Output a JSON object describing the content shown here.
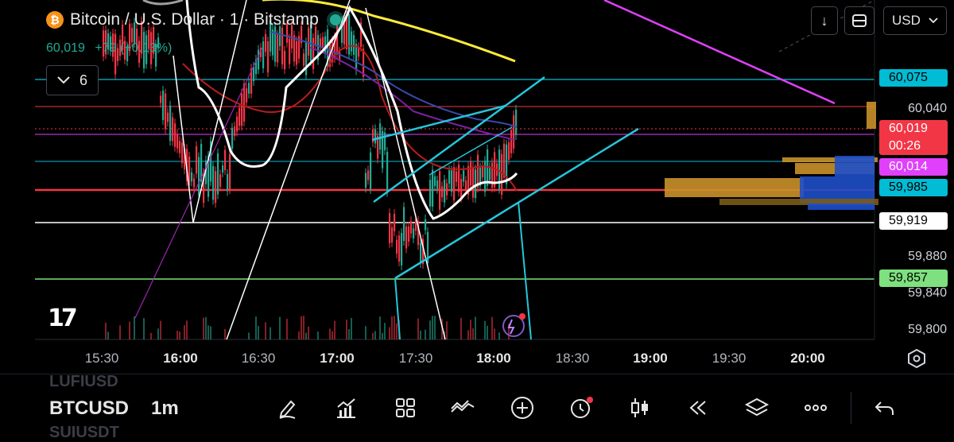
{
  "header": {
    "logo_glyph": "₿",
    "symbol_title": "Bitcoin / U.S. Dollar · 1 · Bitstamp",
    "last_price": "60,019",
    "change": "+79 (+0.13%)",
    "indicators_count": "6",
    "currency": "USD",
    "download_icon": "↓"
  },
  "price_axis": {
    "labels": [
      "60,040",
      "59,880",
      "59,840",
      "59,800"
    ],
    "badges": [
      {
        "text": "60,075",
        "bg": "#00bcd4",
        "fg": "#000000"
      },
      {
        "text": "60,019",
        "bg": "#f23645",
        "fg": "#ffffff"
      },
      {
        "text": "00:26",
        "bg": "#f23645",
        "fg": "#ffffff"
      },
      {
        "text": "60,014",
        "bg": "#e040fb",
        "fg": "#ffffff"
      },
      {
        "text": "59,985",
        "bg": "#00bcd4",
        "fg": "#000000"
      },
      {
        "text": "59,919",
        "bg": "#ffffff",
        "fg": "#000000"
      },
      {
        "text": "59,857",
        "bg": "#7ee07e",
        "fg": "#000000"
      }
    ]
  },
  "time_axis": {
    "labels": [
      {
        "text": "15:30",
        "major": false
      },
      {
        "text": "16:00",
        "major": true
      },
      {
        "text": "16:30",
        "major": false
      },
      {
        "text": "17:00",
        "major": true
      },
      {
        "text": "17:30",
        "major": false
      },
      {
        "text": "18:00",
        "major": true
      },
      {
        "text": "18:30",
        "major": false
      },
      {
        "text": "19:00",
        "major": true
      },
      {
        "text": "19:30",
        "major": false
      },
      {
        "text": "20:00",
        "major": true
      }
    ]
  },
  "branding": {
    "logo_text": "17"
  },
  "bottom_bar": {
    "prev_symbol": "LUFIUSD",
    "symbol": "BTCUSD",
    "next_symbol": "SUIUSDT",
    "interval": "1m",
    "tools": [
      "pencil-icon",
      "indicators-icon",
      "grid-icon",
      "drawings-icon",
      "plus-icon",
      "alert-icon",
      "candle-type-icon",
      "replay-icon",
      "layers-icon",
      "more-icon"
    ],
    "undo_icon": "undo-icon"
  },
  "colors": {
    "up": "#22ab94",
    "down": "#f23645",
    "accent_cyan": "#00bcd4",
    "magenta": "#e040fb"
  }
}
